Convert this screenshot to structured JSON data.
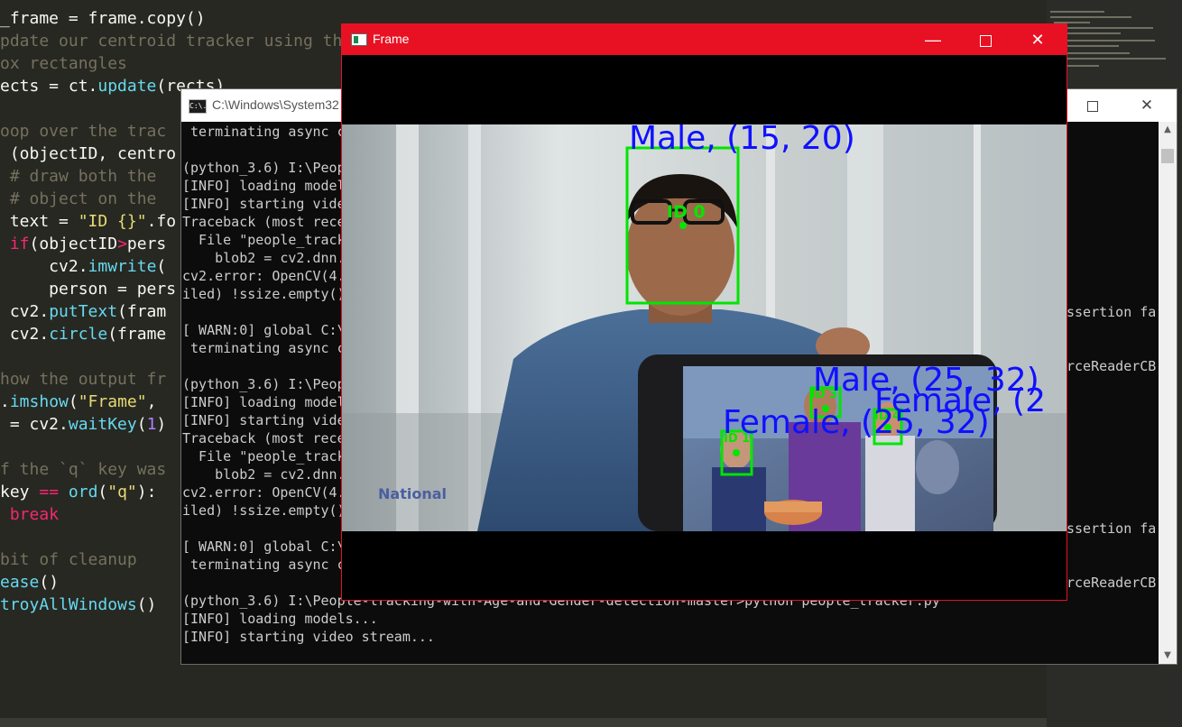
{
  "editor": {
    "lines": [
      {
        "segments": [
          [
            "_frame = frame.copy()",
            ""
          ]
        ]
      },
      {
        "segments": [
          [
            "pdate our centroid tracker using the computed set of bounding",
            "cm"
          ]
        ]
      },
      {
        "segments": [
          [
            "ox rectangles",
            "cm"
          ]
        ]
      },
      {
        "segments": [
          [
            "ects = ct.",
            ""
          ],
          [
            "update",
            "fn"
          ],
          [
            "(rects)",
            ""
          ]
        ]
      },
      {
        "segments": [
          [
            "",
            ""
          ]
        ]
      },
      {
        "segments": [
          [
            "oop over the trac",
            "cm"
          ]
        ]
      },
      {
        "segments": [
          [
            " (objectID, centro",
            ""
          ]
        ]
      },
      {
        "segments": [
          [
            " # draw both the ",
            "cm"
          ]
        ]
      },
      {
        "segments": [
          [
            " # object on the ",
            "cm"
          ]
        ]
      },
      {
        "segments": [
          [
            " text = ",
            ""
          ],
          [
            "\"ID {}\"",
            "str"
          ],
          [
            ".fo",
            ""
          ]
        ]
      },
      {
        "segments": [
          [
            " ",
            ""
          ],
          [
            "if",
            "kw"
          ],
          [
            "(objectID",
            ""
          ],
          [
            ">",
            "kw"
          ],
          [
            "pers",
            ""
          ]
        ]
      },
      {
        "segments": [
          [
            "     cv2.",
            ""
          ],
          [
            "imwrite",
            "fn"
          ],
          [
            "(",
            ""
          ]
        ]
      },
      {
        "segments": [
          [
            "     person = pers",
            ""
          ]
        ]
      },
      {
        "segments": [
          [
            " cv2.",
            ""
          ],
          [
            "putText",
            "fn"
          ],
          [
            "(fram",
            ""
          ]
        ]
      },
      {
        "segments": [
          [
            " cv2.",
            ""
          ],
          [
            "circle",
            "fn"
          ],
          [
            "(frame",
            ""
          ]
        ]
      },
      {
        "segments": [
          [
            "",
            ""
          ]
        ]
      },
      {
        "segments": [
          [
            "how the output fr",
            "cm"
          ]
        ]
      },
      {
        "segments": [
          [
            ".",
            ""
          ],
          [
            "imshow",
            "fn"
          ],
          [
            "(",
            ""
          ],
          [
            "\"Frame\"",
            "str"
          ],
          [
            ", ",
            ""
          ]
        ]
      },
      {
        "segments": [
          [
            " = cv2.",
            ""
          ],
          [
            "waitKey",
            "fn"
          ],
          [
            "(",
            ""
          ],
          [
            "1",
            "var"
          ],
          [
            ")",
            ""
          ]
        ]
      },
      {
        "segments": [
          [
            "",
            ""
          ]
        ]
      },
      {
        "segments": [
          [
            "f the `q` key was",
            "cm"
          ]
        ]
      },
      {
        "segments": [
          [
            "key ",
            ""
          ],
          [
            "==",
            "kw"
          ],
          [
            " ",
            ""
          ],
          [
            "ord",
            "fn"
          ],
          [
            "(",
            ""
          ],
          [
            "\"q\"",
            "str"
          ],
          [
            "):",
            ""
          ]
        ]
      },
      {
        "segments": [
          [
            " ",
            ""
          ],
          [
            "break",
            "kw"
          ]
        ]
      },
      {
        "segments": [
          [
            "",
            ""
          ]
        ]
      },
      {
        "segments": [
          [
            "bit of cleanup",
            "cm"
          ]
        ]
      },
      {
        "segments": [
          [
            "ease",
            "fn"
          ],
          [
            "()",
            ""
          ]
        ]
      },
      {
        "segments": [
          [
            "troyAllWindows",
            "fn"
          ],
          [
            "()",
            ""
          ]
        ]
      }
    ]
  },
  "cmd_window": {
    "title": "C:\\Windows\\System32",
    "icon_label": "C:\\.",
    "icons": {
      "minimize": "minimize-icon",
      "maximize": "maximize-icon",
      "close": "close-icon"
    },
    "lines": [
      " terminating async c",
      "",
      "(python_3.6) I:\\Peop",
      "[INFO] loading model",
      "[INFO] starting vide",
      "Traceback (most rece",
      "  File \"people_track",
      "    blob2 = cv2.dnn.",
      "cv2.error: OpenCV(4.",
      "iled) !ssize.empty()",
      "",
      "[ WARN:0] global C:\\",
      " terminating async c",
      "",
      "(python_3.6) I:\\Peop",
      "[INFO] loading model",
      "[INFO] starting vide",
      "Traceback (most rece",
      "  File \"people_track",
      "    blob2 = cv2.dnn.",
      "cv2.error: OpenCV(4.",
      "iled) !ssize.empty()",
      "",
      "[ WARN:0] global C:\\",
      " terminating async c",
      "",
      "(python_3.6) I:\\People-tracking-with-Age-and-Gender-detection-master>python people_tracker.py",
      "[INFO] loading models...",
      "[INFO] starting video stream..."
    ],
    "right_fragments": [
      "ssertion fa",
      "rceReaderCB",
      "ssertion fa",
      "rceReaderCB"
    ]
  },
  "frame_window": {
    "title": "Frame",
    "icons": {
      "minimize": "minimize-icon",
      "maximize": "maximize-icon",
      "close": "close-icon"
    },
    "detections": [
      {
        "label": "Male, (15, 20)",
        "id": "ID 0"
      },
      {
        "label": "Male, (25, 32)",
        "id": "ID 3"
      },
      {
        "label": "Female, (2",
        "id": "ID 4"
      },
      {
        "label": "Female, (25, 32)",
        "id": "ID 1"
      }
    ],
    "background_text": "National",
    "colors": {
      "box": "#00e600",
      "label": "#1010ff",
      "titlebar": "#e81123"
    }
  }
}
